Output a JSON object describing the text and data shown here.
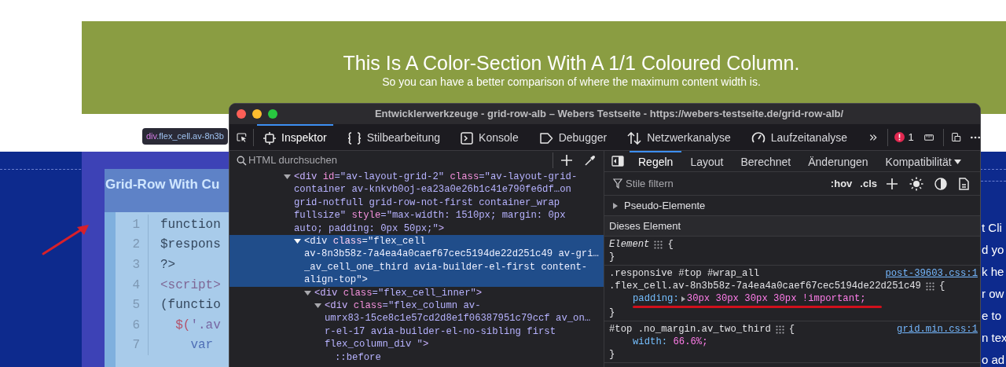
{
  "page": {
    "banner": {
      "title": "This Is A Color-Section With A 1/1 Coloured Column.",
      "subtitle": "So you can have a better comparison of where the maximum content width is."
    },
    "tooltip": {
      "tag": "div",
      "selector": ".flex_cell.av-8n3b"
    },
    "section_heading": "Grid-Row With Cu",
    "code_lines": [
      {
        "number": "1",
        "segs": [
          {
            "kind": "plain",
            "text": "function"
          }
        ]
      },
      {
        "number": "2",
        "segs": [
          {
            "kind": "plain",
            "text": "$respons"
          }
        ]
      },
      {
        "number": "3",
        "segs": [
          {
            "kind": "plain",
            "text": "?>"
          }
        ]
      },
      {
        "number": "4",
        "segs": [
          {
            "kind": "tag",
            "text": "<script>"
          }
        ]
      },
      {
        "number": "5",
        "segs": [
          {
            "kind": "plain",
            "text": "(functio"
          }
        ]
      },
      {
        "number": "6",
        "segs": [
          {
            "kind": "fn",
            "text": "  $("
          },
          {
            "kind": "string",
            "text": "'.av"
          }
        ]
      },
      {
        "number": "7",
        "segs": [
          {
            "kind": "keyword",
            "text": "    var"
          }
        ]
      }
    ],
    "side_text": [
      "t Cli",
      "d yo",
      "k he",
      "r ow",
      "e to",
      "n tex",
      "o ad"
    ]
  },
  "devtools": {
    "title": "Entwicklerwerkzeuge - grid-row-alb – Webers Testseite - https://webers-testseite.de/grid-row-alb/",
    "tools": [
      {
        "kind": "inspector",
        "label": "Inspektor",
        "selected": true
      },
      {
        "kind": "style",
        "label": "Stilbearbeitung",
        "selected": false
      },
      {
        "kind": "console",
        "label": "Konsole",
        "selected": false
      },
      {
        "kind": "debugger",
        "label": "Debugger",
        "selected": false
      },
      {
        "kind": "network",
        "label": "Netzwerkanalyse",
        "selected": false
      },
      {
        "kind": "performance",
        "label": "Laufzeitanalyse",
        "selected": false
      }
    ],
    "error_count": "1",
    "search": {
      "placeholder": "HTML durchsuchen"
    },
    "tree": [
      {
        "expanded": true,
        "selected": false,
        "lines": [
          [
            {
              "kind": "tag",
              "text": "<div "
            },
            {
              "kind": "attr",
              "text": "id"
            },
            {
              "kind": "value",
              "text": "=\"av-layout-grid-2\" "
            },
            {
              "kind": "attr",
              "text": "class"
            },
            {
              "kind": "value",
              "text": "=\"av-layout-grid-"
            }
          ],
          [
            {
              "kind": "value",
              "text": "container av-knkvb0oj-ea23a0e26b1c41e790fe6df…on"
            }
          ],
          [
            {
              "kind": "value",
              "text": "grid-notfull grid-row-not-first container_wrap"
            }
          ],
          [
            {
              "kind": "value",
              "text": "fullsize\" "
            },
            {
              "kind": "attr",
              "text": "style"
            },
            {
              "kind": "value",
              "text": "=\"max-width: 1510px; margin: 0px"
            }
          ],
          [
            {
              "kind": "value",
              "text": "auto; padding: 0px 50px;\""
            },
            {
              "kind": "tag",
              "text": ">"
            }
          ]
        ],
        "children": [
          {
            "expanded": true,
            "selected": true,
            "lines": [
              [
                {
                  "kind": "tag",
                  "text": "<div "
                },
                {
                  "kind": "attr",
                  "text": "class"
                },
                {
                  "kind": "value",
                  "text": "=\"flex_cell"
                }
              ],
              [
                {
                  "kind": "value",
                  "text": "av-8n3b58z-7a4ea4a0caef67cec5194de22d251c49 av-gri…"
                }
              ],
              [
                {
                  "kind": "value",
                  "text": "_av_cell_one_third avia-builder-el-first content-"
                }
              ],
              [
                {
                  "kind": "value",
                  "text": "align-top\""
                },
                {
                  "kind": "tag",
                  "text": ">"
                }
              ]
            ],
            "children": [
              {
                "expanded": true,
                "selected": false,
                "lines": [
                  [
                    {
                      "kind": "tag",
                      "text": "<div "
                    },
                    {
                      "kind": "attr",
                      "text": "class"
                    },
                    {
                      "kind": "value",
                      "text": "=\"flex_cell_inner\""
                    },
                    {
                      "kind": "tag",
                      "text": ">"
                    }
                  ]
                ],
                "children": [
                  {
                    "expanded": true,
                    "selected": false,
                    "lines": [
                      [
                        {
                          "kind": "tag",
                          "text": "<div "
                        },
                        {
                          "kind": "attr",
                          "text": "class"
                        },
                        {
                          "kind": "value",
                          "text": "=\"flex_column av-"
                        }
                      ],
                      [
                        {
                          "kind": "value",
                          "text": "umrx83-15ce8c1e57cd2d8e1f06387951c79ccf av_on…"
                        }
                      ],
                      [
                        {
                          "kind": "value",
                          "text": "r-el-17 avia-builder-el-no-sibling first"
                        }
                      ],
                      [
                        {
                          "kind": "value",
                          "text": "flex_column_div \""
                        },
                        {
                          "kind": "tag",
                          "text": ">"
                        }
                      ]
                    ],
                    "children": [
                      {
                        "selected": false,
                        "lines": [
                          [
                            {
                              "kind": "pseudo",
                              "text": "::before"
                            }
                          ]
                        ]
                      }
                    ]
                  }
                ]
              }
            ]
          }
        ]
      }
    ],
    "sidebar_tabs": [
      {
        "label": "Regeln",
        "selected": true,
        "dropdown": false
      },
      {
        "label": "Layout",
        "selected": false,
        "dropdown": false
      },
      {
        "label": "Berechnet",
        "selected": false,
        "dropdown": false
      },
      {
        "label": "Änderungen",
        "selected": false,
        "dropdown": false
      },
      {
        "label": "Kompatibilität",
        "selected": false,
        "dropdown": true
      }
    ],
    "filter": {
      "placeholder": "Stile filtern",
      "buttons": [
        ":hov",
        ".cls"
      ]
    },
    "pseudo_elements": {
      "label": "Pseudo-Elemente",
      "expanded": false
    },
    "section_label": "Dieses Element",
    "rules": [
      {
        "kind": "element",
        "selector": [
          "Element"
        ],
        "open": "{",
        "close": "}"
      },
      {
        "kind": "rule",
        "selector": [
          ".responsive #top #wrap_all",
          ".flex_cell.av-8n3b58z-7a4ea4a0caef67cec5194de22d251c49"
        ],
        "source": "post-39603.css:1",
        "open": "{",
        "close": "}",
        "declarations": [
          {
            "property": "padding:",
            "value": "30px 30px 30px 30px !important;",
            "expandable": true,
            "underlined": true
          }
        ]
      },
      {
        "kind": "rule",
        "selector": [
          "#top .no_margin.av_two_third"
        ],
        "source": "grid.min.css:1",
        "open": "{",
        "close": "}",
        "declarations": [
          {
            "property": "width:",
            "value": "66.6%;",
            "expandable": false,
            "underlined": false
          }
        ]
      }
    ]
  }
}
